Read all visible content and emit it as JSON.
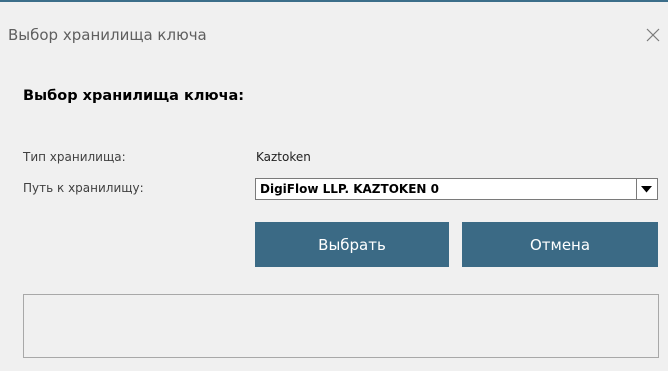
{
  "window": {
    "title": "Выбор хранилища ключа"
  },
  "dialog": {
    "heading": "Выбор хранилища ключа:",
    "storage_type_label": "Тип хранилища:",
    "storage_type_value": "Kaztoken",
    "storage_path_label": "Путь к хранилищу:",
    "storage_path_selected": "DigiFlow LLP. KAZTOKEN 0",
    "select_button_label": "Выбрать",
    "cancel_button_label": "Отмена",
    "status_text": ""
  },
  "icons": {
    "close": "close-icon",
    "dropdown": "chevron-down-icon"
  },
  "colors": {
    "accent": "#3b6a85",
    "background": "#f0f0f0"
  }
}
